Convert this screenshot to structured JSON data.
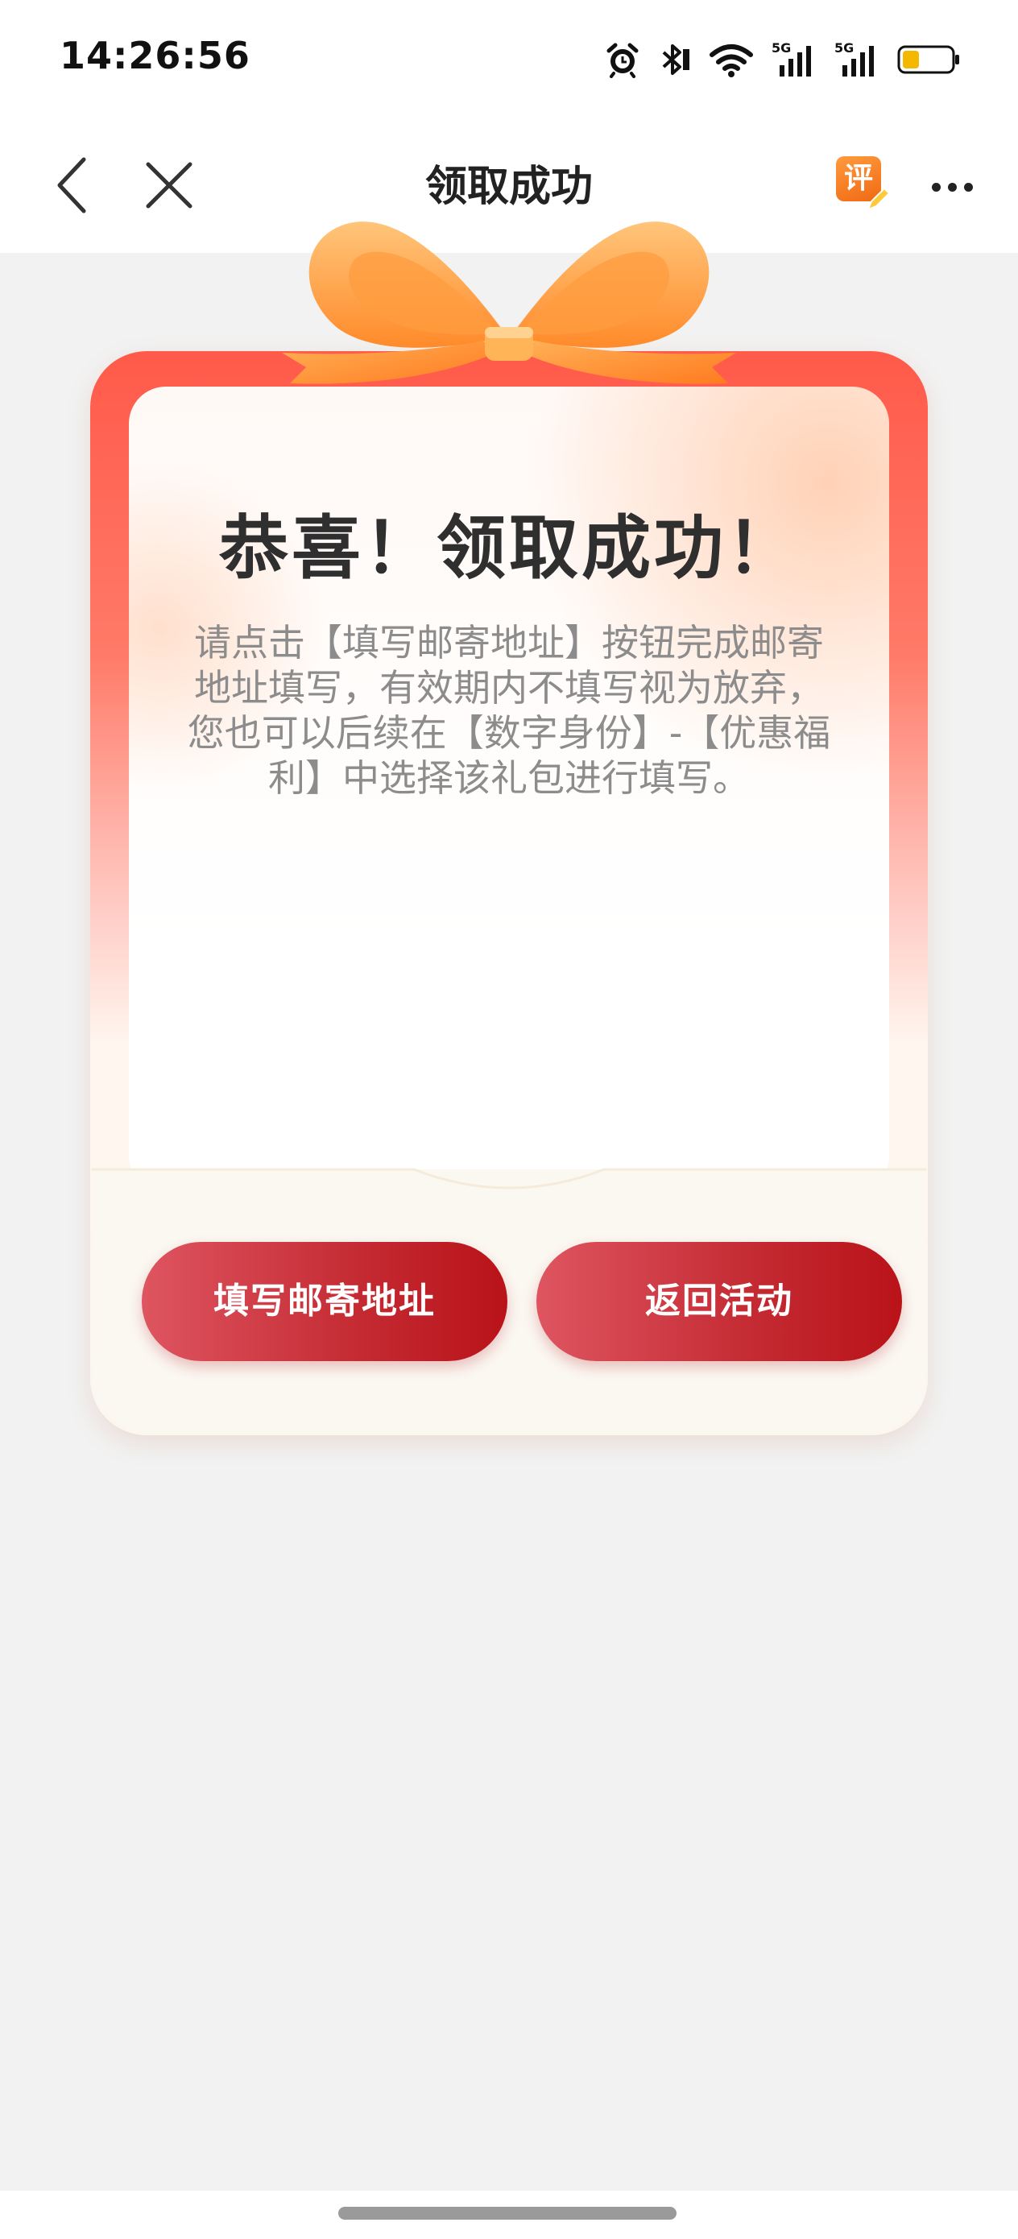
{
  "status_bar": {
    "time": "14:26:56",
    "icons": [
      "alarm-icon",
      "bluetooth-icon",
      "wifi-icon",
      "signal-5g-icon",
      "signal-5g-icon",
      "battery-icon"
    ],
    "network_labels": [
      "5G",
      "5G"
    ],
    "battery_level": 0.35
  },
  "nav": {
    "title": "领取成功",
    "rate_label": "评",
    "icons": [
      "back-arrow-icon",
      "close-icon",
      "rate-icon",
      "more-icon"
    ]
  },
  "card": {
    "title": "恭喜！领取成功！",
    "description": "请点击【填写邮寄地址】按钮完成邮寄地址填写，有效期内不填写视为放弃，您也可以后续在【数字身份】-【优惠福利】中选择该礼包进行填写。",
    "buttons": {
      "fill_address": "填写邮寄地址",
      "return_activity": "返回活动"
    }
  },
  "colors": {
    "accent_red": "#c42a32",
    "bow_orange": "#ff9a3d",
    "background": "#f2f2f2"
  }
}
